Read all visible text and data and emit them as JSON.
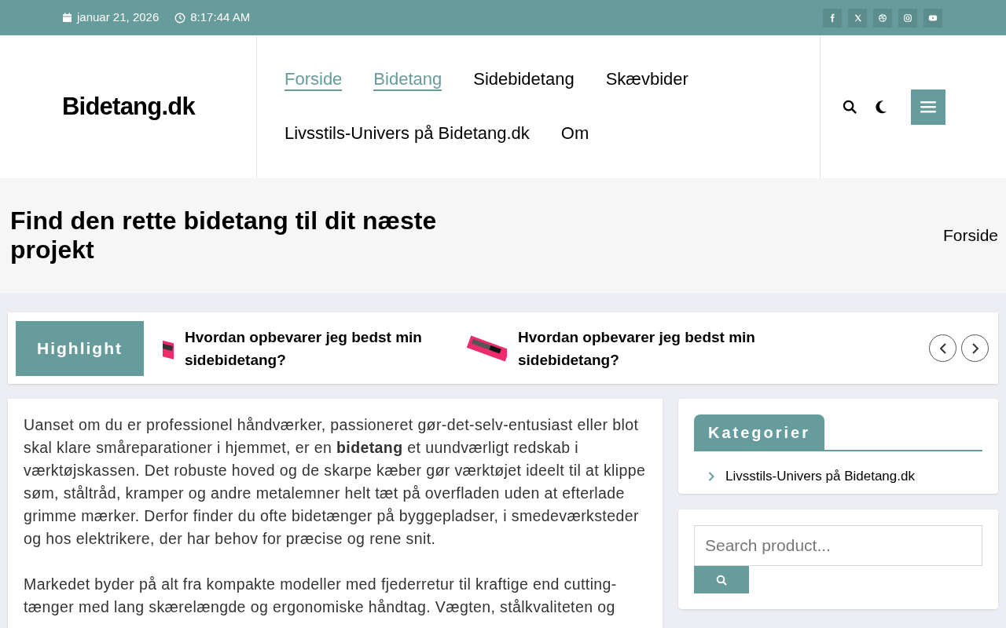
{
  "top_bar": {
    "date": "januar 21, 2026",
    "time": "8:17:44 AM",
    "social": [
      {
        "kind": "facebook"
      },
      {
        "kind": "x"
      },
      {
        "kind": "dribbble"
      },
      {
        "kind": "instagram"
      },
      {
        "kind": "youtube"
      }
    ]
  },
  "header": {
    "logo": "Bidetang.dk",
    "nav": [
      {
        "label": "Forside",
        "selected": true
      },
      {
        "label": "Bidetang",
        "selected": true
      },
      {
        "label": "Sidebidetang",
        "selected": false
      },
      {
        "label": "Skævbider",
        "selected": false
      },
      {
        "label": "Livsstils-Univers på Bidetang.dk",
        "selected": false
      },
      {
        "label": "Om",
        "selected": false
      }
    ]
  },
  "banner": {
    "title": "Find den rette bidetang til dit næste projekt",
    "breadcrumb": "Forside"
  },
  "highlight": {
    "label": "Highlight",
    "items": [
      {
        "title": "Hvordan opbevarer jeg bedst min sidebidetang?"
      },
      {
        "title": "Hvordan opbevarer jeg bedst min sidebidetang?"
      }
    ]
  },
  "article": {
    "paragraphs": [
      "Uanset om du er professionel håndværker, passioneret gør-det-selv-entusiast eller blot skal klare småreparationer i hjemmet, er en **bidetang** et uundværligt redskab i værktøjskassen. Det robuste hoved og de skarpe kæber gør værktøjet ideelt til at klippe søm, ståltråd, kramper og andre metalemner helt tæt på overfladen uden at efterlade grimme mærker. Derfor finder du ofte bidetænger på byggepladser, i smedeværksteder og hos elektrikere, der har behov for præcise og rene snit.",
      "Markedet byder på alt fra kompakte modeller med fjederretur til kraftige end cutting-tænger med lang skærelængde og ergonomiske håndtag. Vægten, stålkvaliteten og"
    ]
  },
  "sidebar": {
    "categories_title": "Kategorier",
    "categories": [
      "Livsstils-Univers på Bidetang.dk"
    ],
    "search": {
      "placeholder": "Search product..."
    }
  }
}
